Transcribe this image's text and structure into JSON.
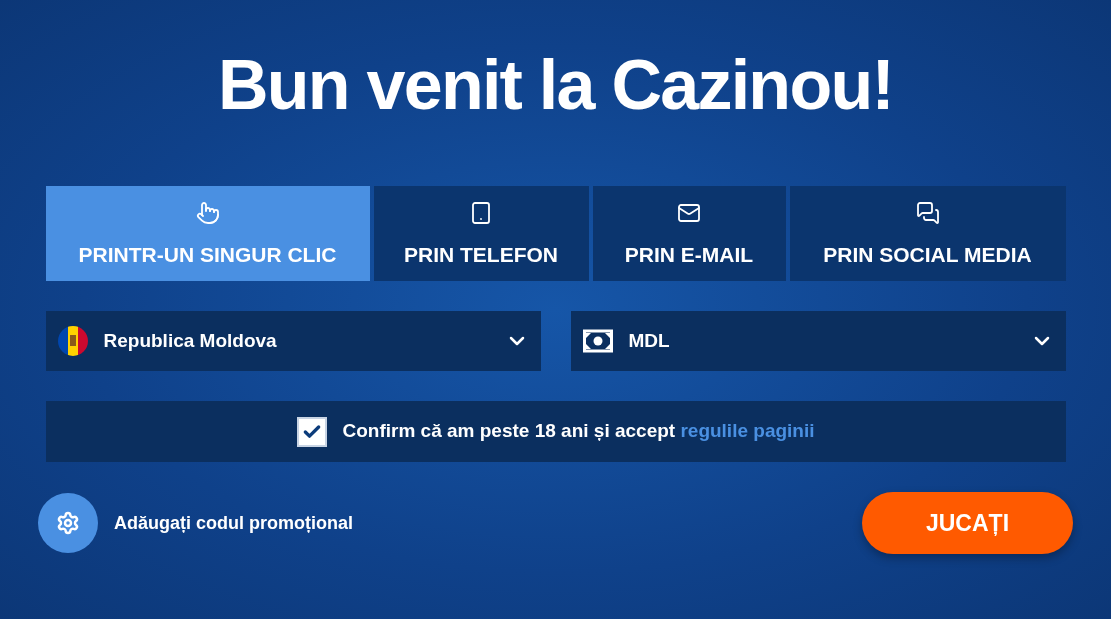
{
  "title": "Bun venit la Cazinou!",
  "tabs": [
    {
      "label": "PRINTR-UN SINGUR CLIC",
      "kind": "click",
      "selected": true
    },
    {
      "label": "PRIN TELEFON",
      "kind": "phone",
      "selected": false
    },
    {
      "label": "PRIN E-MAIL",
      "kind": "email",
      "selected": false
    },
    {
      "label": "PRIN SOCIAL MEDIA",
      "kind": "social",
      "selected": false
    }
  ],
  "country_select": {
    "value": "Republica Moldova"
  },
  "currency_select": {
    "value": "MDL"
  },
  "agreement": {
    "checked": true,
    "text": "Confirm că am peste 18 ani și accept",
    "link": "regulile paginii"
  },
  "promo": {
    "label": "Adăugați codul promoțional"
  },
  "play_button": {
    "label": "JUCAȚI"
  }
}
